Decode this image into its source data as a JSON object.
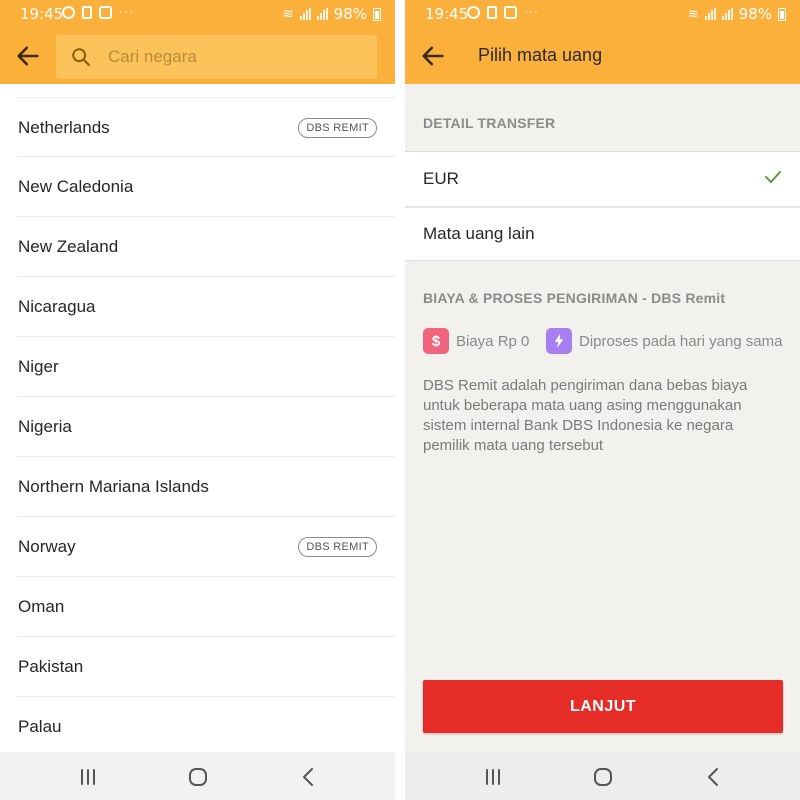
{
  "status_bar": {
    "time": "19:45",
    "battery": "98%"
  },
  "country_screen": {
    "search": {
      "placeholder": "Cari negara"
    },
    "countries": [
      {
        "name": "Netherlands",
        "badge": "DBS REMIT"
      },
      {
        "name": "New Caledonia",
        "badge": ""
      },
      {
        "name": "New Zealand",
        "badge": ""
      },
      {
        "name": "Nicaragua",
        "badge": ""
      },
      {
        "name": "Niger",
        "badge": ""
      },
      {
        "name": "Nigeria",
        "badge": ""
      },
      {
        "name": "Northern Mariana Islands",
        "badge": ""
      },
      {
        "name": "Norway",
        "badge": "DBS REMIT"
      },
      {
        "name": "Oman",
        "badge": ""
      },
      {
        "name": "Pakistan",
        "badge": ""
      },
      {
        "name": "Palau",
        "badge": ""
      }
    ]
  },
  "currency_screen": {
    "title": "Pilih mata uang",
    "section_transfer": "DETAIL TRANSFER",
    "currencies": [
      {
        "label": "EUR",
        "selected": true
      },
      {
        "label": "Mata uang lain",
        "selected": false
      }
    ],
    "section_fees": "BIAYA & PROSES PENGIRIMAN - DBS Remit",
    "fee_label": "Biaya Rp 0",
    "process_label": "Diproses pada hari yang sama",
    "description": "DBS Remit adalah pengiriman dana bebas biaya untuk beberapa mata uang asing menggunakan sistem internal Bank DBS Indonesia ke negara pemilik mata uang tersebut",
    "continue_label": "LANJUT"
  },
  "colors": {
    "header": "#fbb03b",
    "primary_button": "#e52c27",
    "check": "#5a9a3a",
    "fee_icon": "#f0657d",
    "process_icon": "#a77ff0"
  }
}
